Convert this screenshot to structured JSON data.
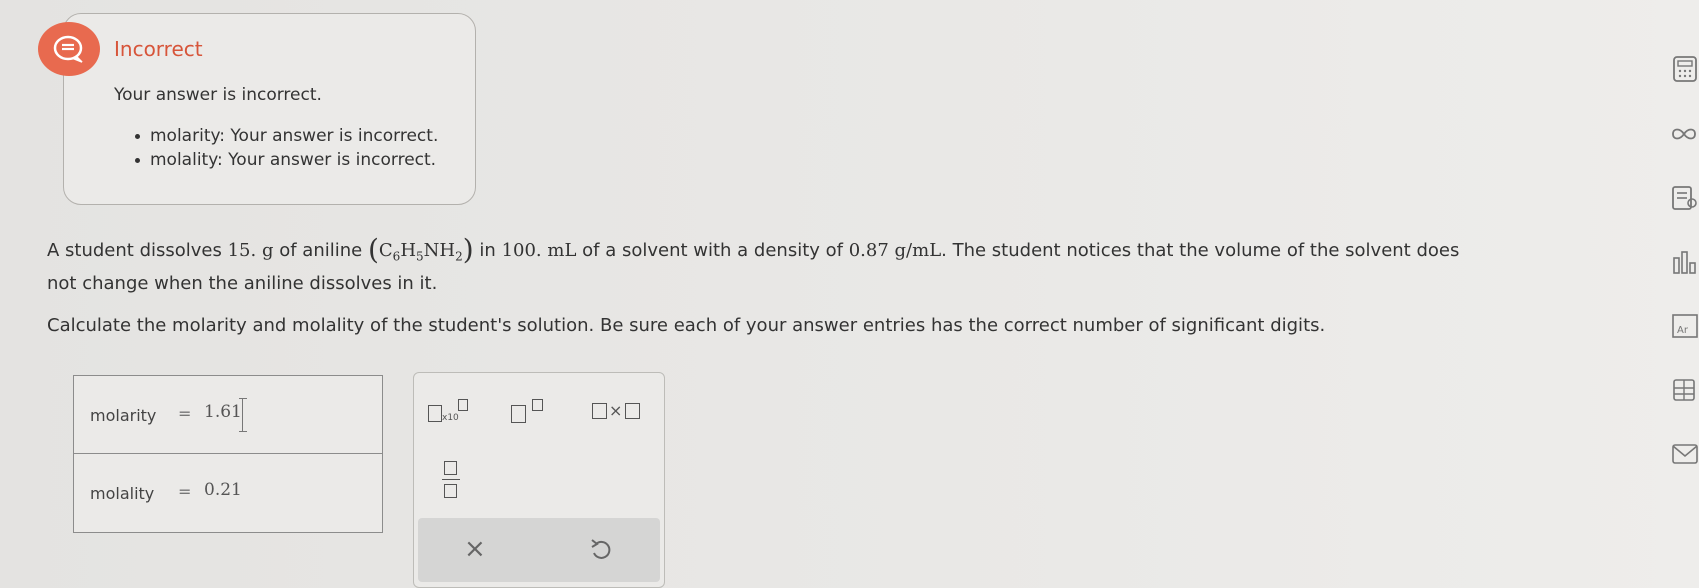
{
  "feedback": {
    "status_title": "Incorrect",
    "summary": "Your answer is incorrect.",
    "items": [
      "molarity: Your answer is incorrect.",
      "molality: Your answer is incorrect."
    ]
  },
  "problem": {
    "text1": "A student dissolves",
    "mass": "15. g",
    "text2": "of aniline",
    "formula_parts": [
      "C",
      "6",
      "H",
      "5",
      "NH",
      "2"
    ],
    "text3": "in",
    "volume": "100. mL",
    "text4": "of a solvent with a density of",
    "density": "0.87  g/mL",
    "text5": ". The student notices that the volume of the solvent does",
    "line2": "not change when the aniline dissolves in it.",
    "question": "Calculate the molarity and molality of the student's solution. Be sure each of your answer entries has the correct number of significant digits."
  },
  "answers": [
    {
      "label": "molarity",
      "eq": "=",
      "value": "1.61"
    },
    {
      "label": "molality",
      "eq": "=",
      "value": "0.21"
    }
  ],
  "tools": {
    "x10_label": "x10",
    "times_label": "×",
    "clear_label": "×"
  },
  "colors": {
    "accent": "#e86a4f",
    "incorrect_text": "#d7553a"
  },
  "icons": {
    "status": "chat-bubble-icon",
    "rail": [
      "calculator-icon",
      "infinity-icon",
      "data-icon",
      "chart-icon",
      "periodic-table-icon",
      "book-icon",
      "mail-icon"
    ]
  }
}
